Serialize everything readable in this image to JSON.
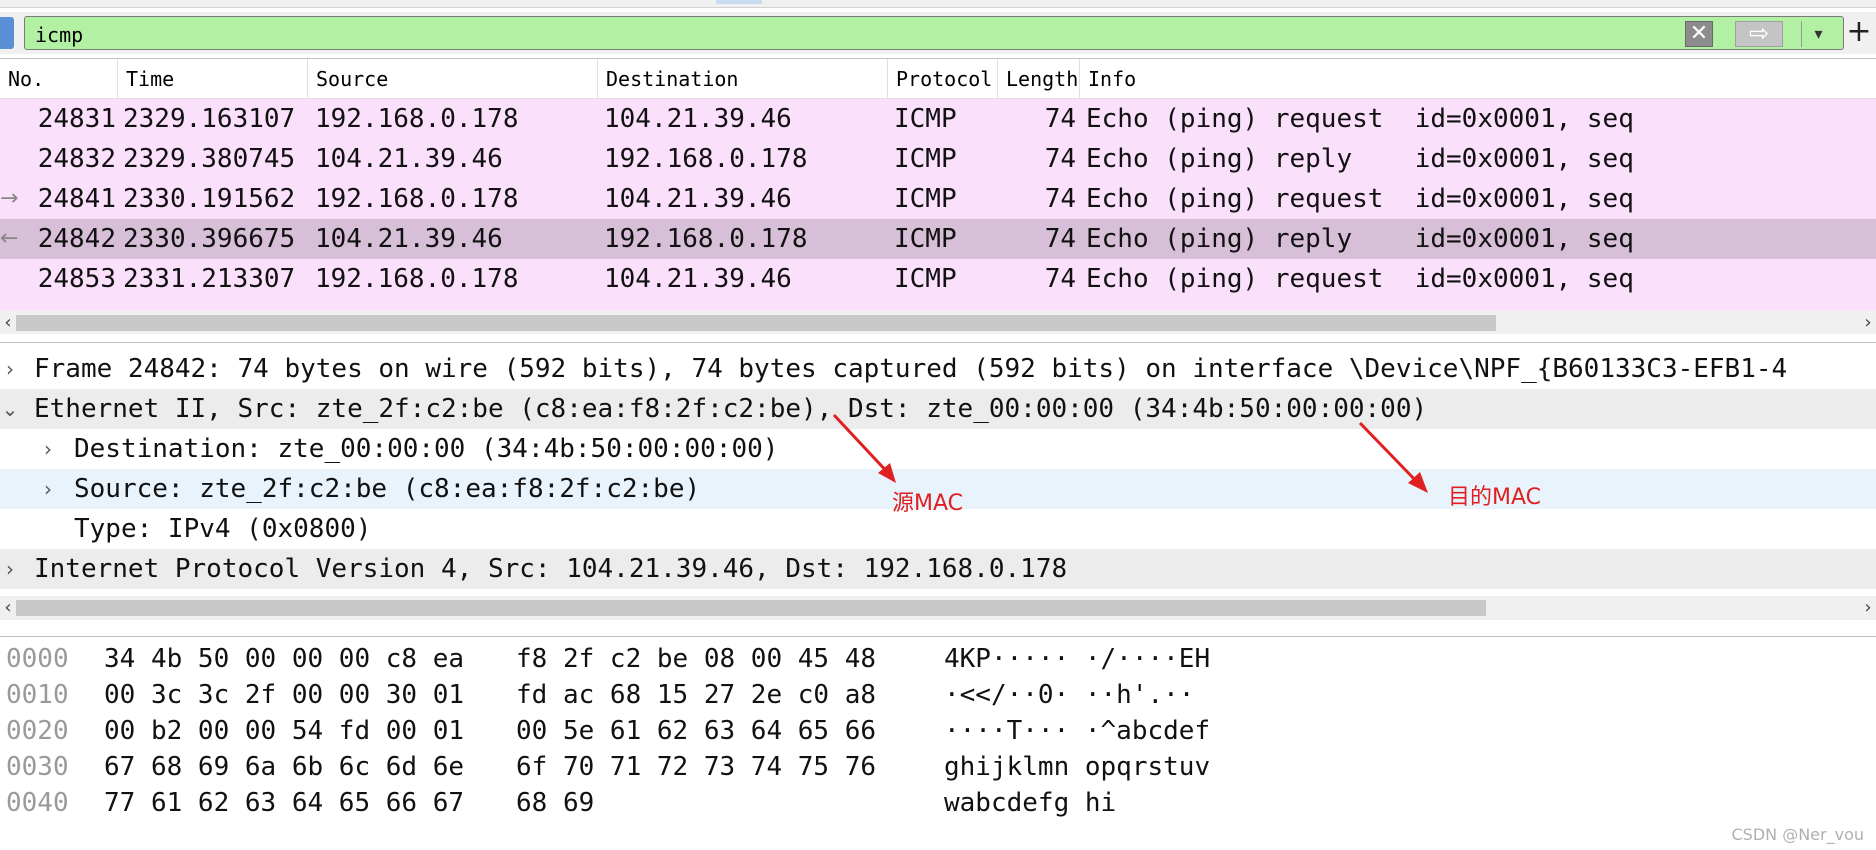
{
  "filter": {
    "value": "icmp",
    "clear_glyph": "✕",
    "apply_glyph": "⇨",
    "dropdown_glyph": "▾",
    "add_glyph": "+"
  },
  "packet_list": {
    "columns": [
      "No.",
      "Time",
      "Source",
      "Destination",
      "Protocol",
      "Length",
      "Info"
    ],
    "rows": [
      {
        "no": "24831",
        "time": "2329.163107",
        "source": "192.168.0.178",
        "destination": "104.21.39.46",
        "protocol": "ICMP",
        "length": "74",
        "info": "Echo (ping) request  id=0x0001, seq"
      },
      {
        "no": "24832",
        "time": "2329.380745",
        "source": "104.21.39.46",
        "destination": "192.168.0.178",
        "protocol": "ICMP",
        "length": "74",
        "info": "Echo (ping) reply    id=0x0001, seq"
      },
      {
        "no": "24841",
        "time": "2330.191562",
        "source": "192.168.0.178",
        "destination": "104.21.39.46",
        "protocol": "ICMP",
        "length": "74",
        "info": "Echo (ping) request  id=0x0001, seq"
      },
      {
        "no": "24842",
        "time": "2330.396675",
        "source": "104.21.39.46",
        "destination": "192.168.0.178",
        "protocol": "ICMP",
        "length": "74",
        "info": "Echo (ping) reply    id=0x0001, seq"
      },
      {
        "no": "24853",
        "time": "2331.213307",
        "source": "192.168.0.178",
        "destination": "104.21.39.46",
        "protocol": "ICMP",
        "length": "74",
        "info": "Echo (ping) request  id=0x0001, seq"
      }
    ]
  },
  "details": {
    "frame": "Frame 24842: 74 bytes on wire (592 bits), 74 bytes captured (592 bits) on interface \\Device\\NPF_{B60133C3-EFB1-4",
    "ethernet": "Ethernet II, Src: zte_2f:c2:be (c8:ea:f8:2f:c2:be), Dst: zte_00:00:00 (34:4b:50:00:00:00)",
    "destination": "Destination: zte_00:00:00 (34:4b:50:00:00:00)",
    "source": "Source: zte_2f:c2:be (c8:ea:f8:2f:c2:be)",
    "type": "Type: IPv4 (0x0800)",
    "ip": "Internet Protocol Version 4, Src: 104.21.39.46, Dst: 192.168.0.178"
  },
  "annotations": {
    "src_mac": "源MAC",
    "dst_mac": "目的MAC",
    "color": "#e02020"
  },
  "bytes": [
    {
      "offset": "0000",
      "hex1": "34 4b 50 00 00 00 c8 ea",
      "hex2": "f8 2f c2 be 08 00 45 48",
      "ascii": "4KP····· ·/····EH"
    },
    {
      "offset": "0010",
      "hex1": "00 3c 3c 2f 00 00 30 01",
      "hex2": "fd ac 68 15 27 2e c0 a8",
      "ascii": "·<</··0· ··h'.··"
    },
    {
      "offset": "0020",
      "hex1": "00 b2 00 00 54 fd 00 01",
      "hex2": "00 5e 61 62 63 64 65 66",
      "ascii": "····T··· ·^abcdef"
    },
    {
      "offset": "0030",
      "hex1": "67 68 69 6a 6b 6c 6d 6e",
      "hex2": "6f 70 71 72 73 74 75 76",
      "ascii": "ghijklmn opqrstuv"
    },
    {
      "offset": "0040",
      "hex1": "77 61 62 63 64 65 66 67",
      "hex2": "68 69",
      "ascii": "wabcdefg hi"
    }
  ],
  "watermark": "CSDN @Ner_vou",
  "colors": {
    "filter_bg": "#b2f0a4",
    "row_bg": "#fbe0fb",
    "row_selected_bg": "#d8bfd8",
    "detail_highlight_bg": "#e8f3fc"
  }
}
